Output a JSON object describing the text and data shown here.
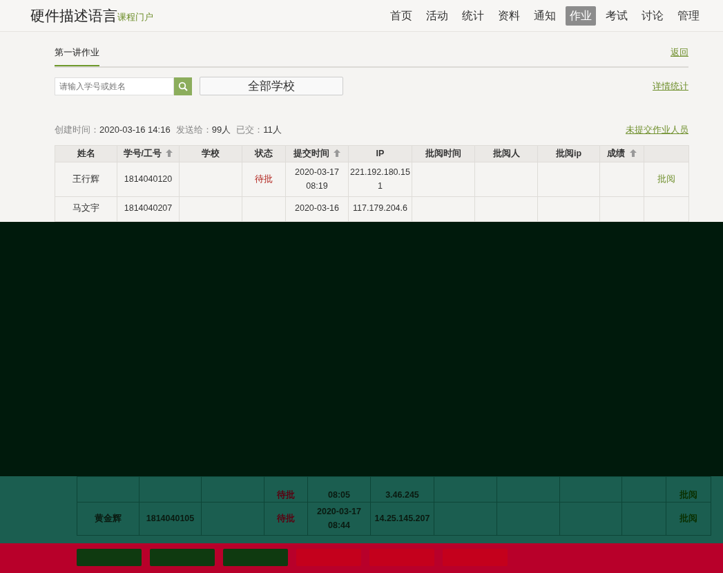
{
  "header": {
    "title": "硬件描述语言",
    "subtitle": "课程门户",
    "nav": [
      {
        "label": "首页",
        "selected": false
      },
      {
        "label": "活动",
        "selected": false
      },
      {
        "label": "统计",
        "selected": false
      },
      {
        "label": "资料",
        "selected": false
      },
      {
        "label": "通知",
        "selected": false
      },
      {
        "label": "作业",
        "selected": true
      },
      {
        "label": "考试",
        "selected": false
      },
      {
        "label": "讨论",
        "selected": false
      },
      {
        "label": "管理",
        "selected": false
      }
    ]
  },
  "tabs": [
    {
      "label": "第一讲作业",
      "selected": true
    }
  ],
  "back_link": "返回",
  "search": {
    "placeholder": "请输入学号或姓名"
  },
  "school_filter": "全部学校",
  "detail_link": "详情统计",
  "summary": [
    {
      "label": "创建时间：",
      "value": "2020-03-16 14:16"
    },
    {
      "label": "发送给：",
      "value": "99人"
    },
    {
      "label": "已交：",
      "value": "11人"
    }
  ],
  "unsubmitted_link": "未提交作业人员",
  "table": {
    "columns": [
      {
        "label": "姓名",
        "sortable": false
      },
      {
        "label": "学号/工号",
        "sortable": true
      },
      {
        "label": "学校",
        "sortable": false
      },
      {
        "label": "状态",
        "sortable": false
      },
      {
        "label": "提交时间",
        "sortable": true
      },
      {
        "label": "IP",
        "sortable": false
      },
      {
        "label": "批阅时间",
        "sortable": false
      },
      {
        "label": "批阅人",
        "sortable": false
      },
      {
        "label": "批阅ip",
        "sortable": false
      },
      {
        "label": "成绩",
        "sortable": true
      },
      {
        "sortable": false
      }
    ],
    "rows": [
      {
        "name": "王行辉",
        "student_id": "1814040120",
        "status": "待批",
        "submitted": "2020-03-17 08:19",
        "ip": "221.192.180.151",
        "action": "批阅"
      },
      {
        "name": "马文宇",
        "student_id": "1814040207",
        "submitted": "2020-03-16",
        "ip": "117.179.204.6"
      }
    ]
  },
  "glitch_rows": [
    {
      "status": "待批",
      "submitted": "08:05",
      "ip": "3.46.245",
      "action": "批阅"
    },
    {
      "name": "黄金辉",
      "student_id": "1814040105",
      "status": "待批",
      "submitted": "2020-03-17 08:44",
      "ip": "14.25.145.207",
      "action": "批阅"
    }
  ],
  "buttons": [
    {
      "color": "#0f3a10"
    },
    {
      "color": "#0f3a10"
    },
    {
      "color": "#0f3a10"
    },
    {
      "color": "#c4001c"
    },
    {
      "color": "#c4001c"
    },
    {
      "color": "#c4001c"
    }
  ]
}
